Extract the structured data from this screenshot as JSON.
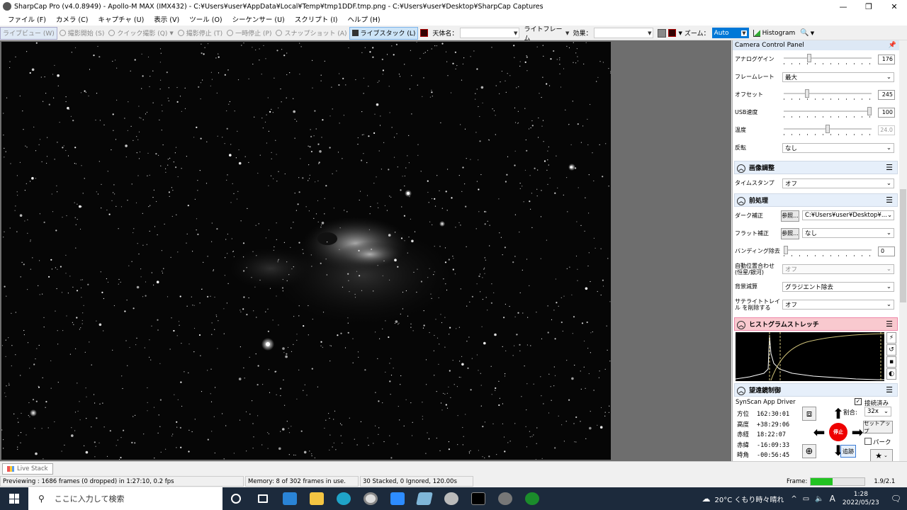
{
  "window": {
    "title": "SharpCap Pro (v4.0.8949) - Apollo-M MAX (IMX432) - C:¥Users¥user¥AppData¥Local¥Temp¥tmp1DDF.tmp.png - C:¥Users¥user¥Desktop¥SharpCap Captures",
    "minimize": "—",
    "restore": "❐",
    "close": "✕"
  },
  "menu": [
    "ファイル (F)",
    "カメラ (C)",
    "キャプチャ (U)",
    "表示 (V)",
    "ツール (O)",
    "シーケンサー (U)",
    "スクリプト (I)",
    "ヘルプ (H)"
  ],
  "toolbar": {
    "live_view": "ライブビュー (W)",
    "start_capture": "撮影開始 (S)",
    "quick_capture": "クイック撮影 (Q)",
    "stop_capture": "撮影停止 (T)",
    "pause": "一時停止 (P)",
    "snapshot": "スナップショット (A)",
    "live_stack": "ライブスタック (L)",
    "target_label": "天体名：",
    "target_value": "",
    "frame_type": "ライトフレーム",
    "effect_label": "効果：",
    "effect_value": "",
    "zoom_label": "ズーム：",
    "zoom_value": "Auto",
    "histogram": "Histogram"
  },
  "panel": {
    "title": "Camera Control Panel",
    "pin": "📌",
    "controls": [
      {
        "label": "アナログゲイン",
        "value": "176",
        "level": 0.28
      },
      {
        "label": "フレームレート",
        "select": "最大"
      },
      {
        "label": "オフセット",
        "value": "245",
        "level": 0.25
      },
      {
        "label": "USB速度",
        "value": "100",
        "level": 1.0
      },
      {
        "label": "温度",
        "value": "24.0",
        "level": 0.5,
        "disabled": true
      },
      {
        "label": "反転",
        "select": "なし"
      }
    ],
    "image_adjust": {
      "title": "画像調整",
      "timestamp_label": "タイムスタンプ",
      "timestamp_value": "オフ"
    },
    "preprocess": {
      "title": "前処理",
      "dark_label": "ダーク補正",
      "browse": "参照...",
      "dark_value": "C:¥Users¥user¥Desktop¥...",
      "flat_label": "フラット補正",
      "flat_value": "なし",
      "banding_label": "バンディング除去",
      "banding_value": "0",
      "autoalign_label": "自動位置合わせ (恒星/銀河)",
      "autoalign_value": "オフ",
      "background_label": "背景減算",
      "background_value": "グラジエント除去",
      "satellite_label": "サテライトトレイル を削除する",
      "satellite_value": "オフ"
    },
    "histogram": {
      "title": "ヒストグラムストレッチ"
    },
    "telescope": {
      "title": "望遠鏡制御",
      "driver": "SynScan App Driver",
      "connected_label": "接続済み",
      "rate_label": "割合:",
      "rate_value": "32x",
      "setup": "セットアップ",
      "park": "パーク",
      "stop": "停止",
      "tracking": "追跡",
      "coords": [
        {
          "label": "方位",
          "value": "162:30:01"
        },
        {
          "label": "高度",
          "value": "+38:29:06"
        },
        {
          "label": "赤経",
          "value": "18:22:07"
        },
        {
          "label": "赤緯",
          "value": "-16:09:33"
        },
        {
          "label": "時角",
          "value": "-00:56:45"
        }
      ]
    }
  },
  "bottom": {
    "live_stack_tab": "Live Stack",
    "status_preview": "Previewing : 1686 frames (0 dropped) in 1:27:10, 0.2 fps",
    "status_memory": "Memory: 8 of 302 frames in use.",
    "status_stack": "30 Stacked, 0 Ignored, 120.00s",
    "frame_label": "Frame:",
    "frame_progress": 0.4,
    "version_ratio": "1.9/2.1"
  },
  "taskbar": {
    "search_placeholder": "ここに入力して検索",
    "weather": "20°C くもり時々晴れ",
    "ime": "A",
    "time": "1:28",
    "date": "2022/05/23"
  },
  "colors": {
    "accent": "#cce4f7",
    "histogram_header": "#f9c9cf",
    "stop_button": "#e00000",
    "frame_progress": "#22c322"
  }
}
